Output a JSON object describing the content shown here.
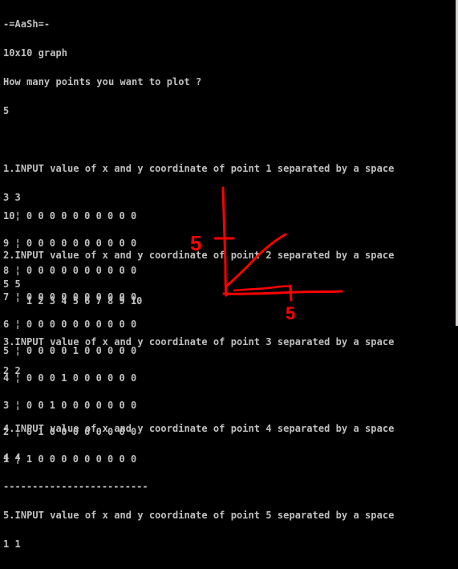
{
  "console": {
    "lines": [
      "-=AaSh=-",
      "10x10 graph",
      "How many points you want to plot ?",
      "5",
      "",
      "1.INPUT value of x and y coordinate of point 1 separated by a space",
      "3 3",
      "",
      "2.INPUT value of x and y coordinate of point 2 separated by a space",
      "5 5",
      "",
      "3.INPUT value of x and y coordinate of point 3 separated by a space",
      "2 2",
      "",
      "4.INPUT value of x and y coordinate of point 4 separated by a space",
      "4 4",
      "",
      "5.INPUT value of x and y coordinate of point 5 separated by a space",
      "1 1"
    ],
    "grid_rows": [
      "10¦ 0 0 0 0 0 0 0 0 0 0",
      "9 ¦ 0 0 0 0 0 0 0 0 0 0",
      "8 ¦ 0 0 0 0 0 0 0 0 0 0",
      "7 ¦ 0 0 0 0 0 0 0 0 0 0",
      "6 ¦ 0 0 0 0 0 0 0 0 0 0",
      "5 ¦ 0 0 0 0 1 0 0 0 0 0",
      "4 ¦ 0 0 0 1 0 0 0 0 0 0",
      "3 ¦ 0 0 1 0 0 0 0 0 0 0",
      "2 ¦ 0 1 0 0 0 0 0 0 0 0",
      "1 ¦ 1 0 0 0 0 0 0 0 0 0",
      "-------------------------"
    ],
    "x_axis": "    1 2 3 4 5 6 7 8 9 10"
  },
  "sketch": {
    "label_y": "5",
    "label_x": "5",
    "color": "#ff0000"
  }
}
